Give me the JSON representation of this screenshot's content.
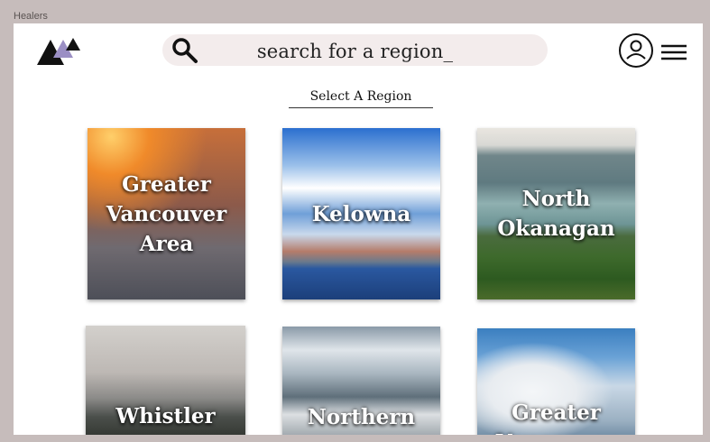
{
  "frame": {
    "label": "Healers"
  },
  "header": {
    "search_placeholder": "search for a region_"
  },
  "section": {
    "title": "Select A Region"
  },
  "regions": [
    {
      "label": "Greater Vancouver Area"
    },
    {
      "label": "Kelowna"
    },
    {
      "label": "North Okanagan"
    },
    {
      "label": "Whistler"
    },
    {
      "label": "Northern"
    },
    {
      "label": "Greater Vancouver"
    }
  ],
  "colors": {
    "background": "#c6bcbb",
    "artboard": "#ffffff",
    "search_field": "#f3ecec",
    "logo_dark": "#111111",
    "logo_accent": "#9b8fc4"
  },
  "icons": [
    "logo-mountains-icon",
    "search-icon",
    "user-avatar-icon",
    "hamburger-menu-icon"
  ]
}
